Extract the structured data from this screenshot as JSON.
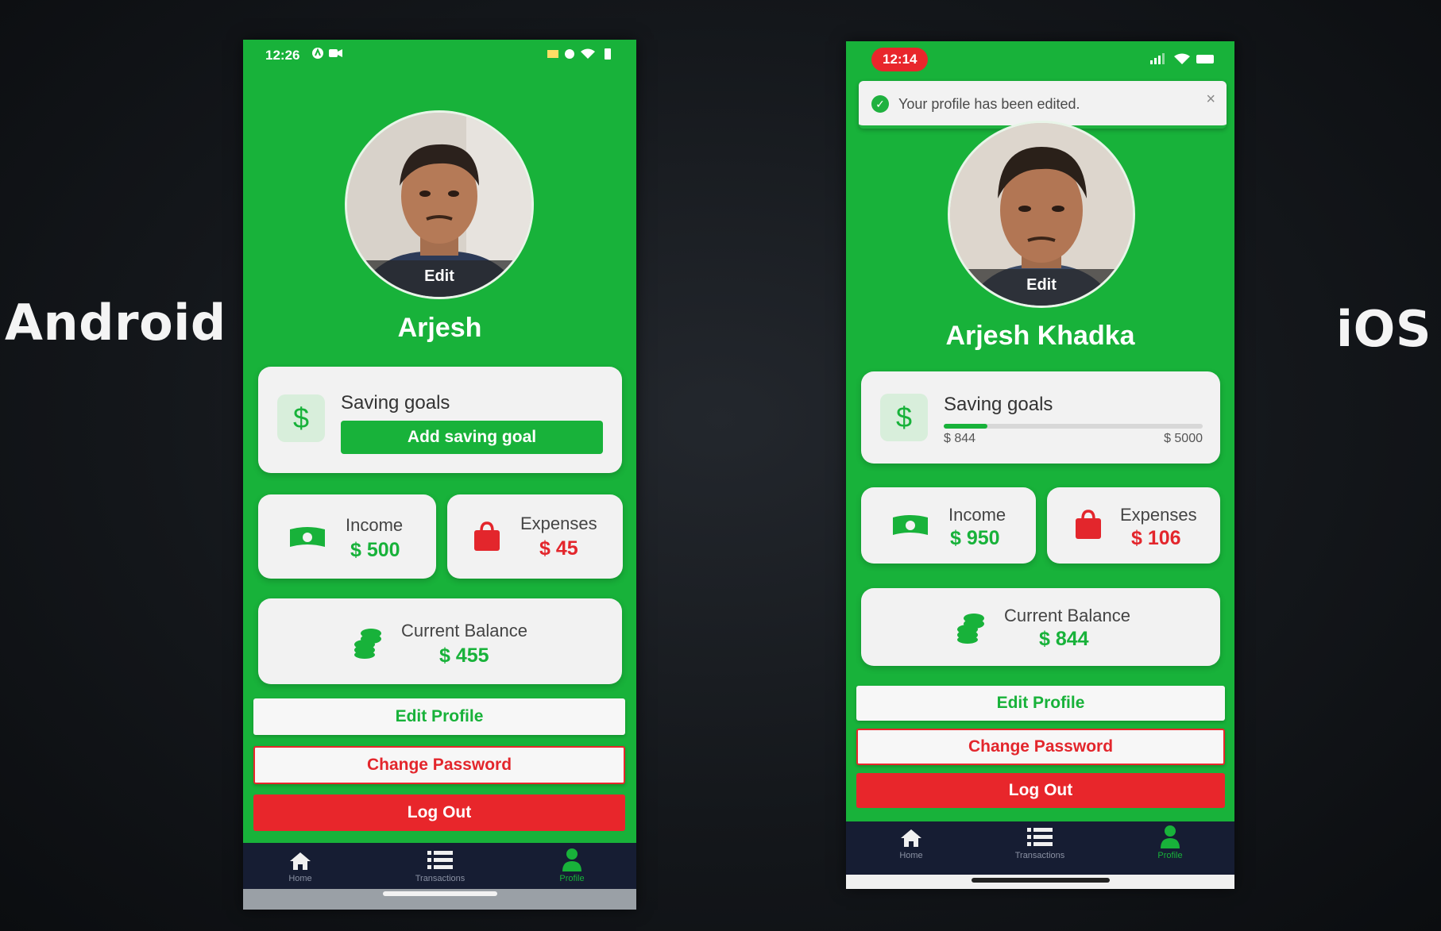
{
  "labels": {
    "android": "Android",
    "ios": "iOS"
  },
  "colors": {
    "brand_green": "#18b23a",
    "danger_red": "#e8262b",
    "tabbar_navy": "#161d33"
  },
  "android": {
    "status_time": "12:26",
    "avatar_edit": "Edit",
    "username": "Arjesh",
    "saving_goals": {
      "title": "Saving goals",
      "button": "Add saving goal",
      "icon": "dollar-icon"
    },
    "income": {
      "label": "Income",
      "value": "$ 500",
      "icon": "cash-icon"
    },
    "expenses": {
      "label": "Expenses",
      "value": "$ 45",
      "icon": "shopping-bag-icon"
    },
    "balance": {
      "label": "Current Balance",
      "value": "$ 455",
      "icon": "coins-icon"
    },
    "buttons": {
      "edit_profile": "Edit Profile",
      "change_password": "Change Password",
      "logout": "Log Out"
    },
    "tabs": [
      {
        "label": "Home",
        "icon": "home-icon"
      },
      {
        "label": "Transactions",
        "icon": "list-icon"
      },
      {
        "label": "Profile",
        "icon": "user-icon",
        "active": true
      }
    ]
  },
  "ios": {
    "status_time": "12:14",
    "toast": "Your profile has been edited.",
    "avatar_edit": "Edit",
    "username": "Arjesh Khadka",
    "saving_goals": {
      "title": "Saving goals",
      "current": "$ 844",
      "target": "$ 5000",
      "progress": 0.1688,
      "icon": "dollar-icon"
    },
    "income": {
      "label": "Income",
      "value": "$ 950",
      "icon": "cash-icon"
    },
    "expenses": {
      "label": "Expenses",
      "value": "$ 106",
      "icon": "shopping-bag-icon"
    },
    "balance": {
      "label": "Current Balance",
      "value": "$ 844",
      "icon": "coins-icon"
    },
    "buttons": {
      "edit_profile": "Edit Profile",
      "change_password": "Change Password",
      "logout": "Log Out"
    },
    "tabs": [
      {
        "label": "Home",
        "icon": "home-icon"
      },
      {
        "label": "Transactions",
        "icon": "list-icon"
      },
      {
        "label": "Profile",
        "icon": "user-icon",
        "active": true
      }
    ]
  }
}
